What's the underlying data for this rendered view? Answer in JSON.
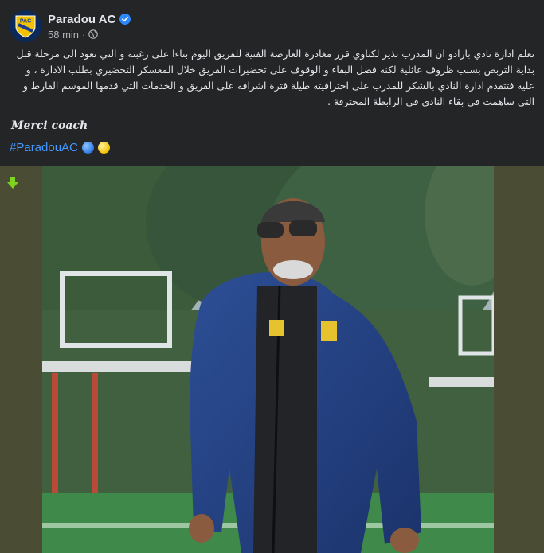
{
  "post": {
    "page_name": "Paradou AC",
    "timestamp": "58 min",
    "separator": "·",
    "body": "تعلم ادارة نادي بارادو ان المدرب نذير لكناوي قرر مغادرة العارضة الفنية للفريق اليوم بناءا على رغبته و التي تعود الى مرحلة قبل بداية التربص بسبب ظروف عائلية لكنه فضل البقاء و الوقوف على تحضيرات الفريق خلال المعسكر التحضيري بطلب الادارة ، و عليه فتتقدم ادارة النادي بالشكر للمدرب على احترافيته طيلة فترة اشرافه على الفريق و الخدمات التي قدمها الموسم الفارط و التي ساهمت في بقاء النادي في الرابطة المحترفة .",
    "closing": "Merci coach",
    "hashtag": "#ParadouAC",
    "emoji": [
      "blue-circle",
      "yellow-circle"
    ]
  },
  "icons": {
    "avatar": "paradou-crest-logo",
    "verified": "verified-badge-icon",
    "privacy": "globe-icon",
    "download": "down-arrow-icon"
  },
  "crest_text": "PAC",
  "colors": {
    "background": "#242526",
    "text": "#e4e6eb",
    "muted": "#b0b3b8",
    "link": "#4599ff",
    "verified": "#2d88ff",
    "media_border": "#4a4c34",
    "arrow": "#7ed321"
  }
}
